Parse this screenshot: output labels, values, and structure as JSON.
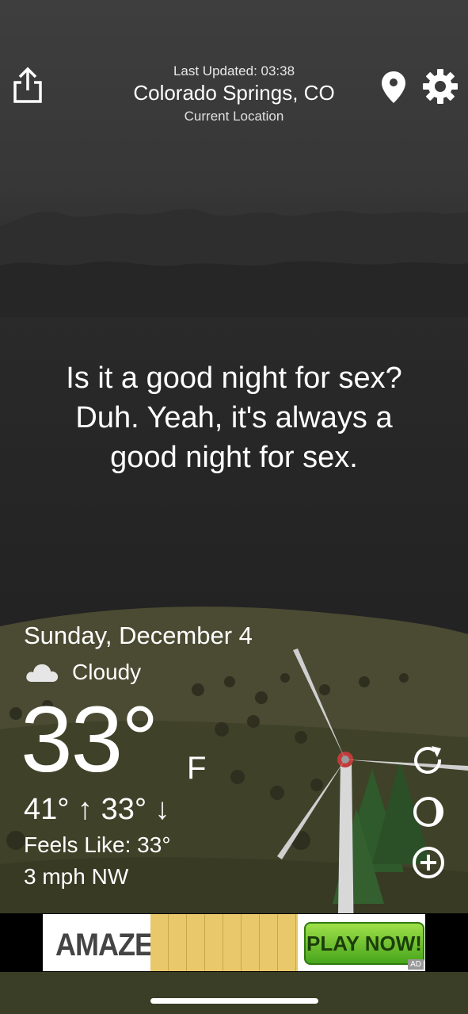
{
  "header": {
    "last_updated": "Last Updated: 03:38",
    "city": "Colorado Springs, CO",
    "subtitle": "Current Location",
    "share_icon": "share-icon",
    "location_icon": "location-pin-icon",
    "settings_icon": "gear-icon"
  },
  "message": {
    "line1": "Is it a good night for sex?",
    "line2": "Duh. Yeah, it's always a",
    "line3": "good night for sex."
  },
  "weather": {
    "date": "Sunday, December 4",
    "condition_icon": "cloud-icon",
    "condition": "Cloudy",
    "temperature": "33°",
    "unit": "F",
    "high_low": "41° ↑  33° ↓",
    "feels_like": "Feels Like: 33°",
    "wind": "3 mph NW"
  },
  "side_actions": {
    "refresh_icon": "refresh-icon",
    "theme_icon": "theme-icon",
    "add_icon": "add-icon"
  },
  "ad": {
    "brand": "AMAZE!",
    "cta": "PLAY NOW!",
    "tag": "AD"
  },
  "colors": {
    "sky": "#2a2a2a",
    "hill": "#4d5032",
    "cta_green": "#6cc22a"
  }
}
